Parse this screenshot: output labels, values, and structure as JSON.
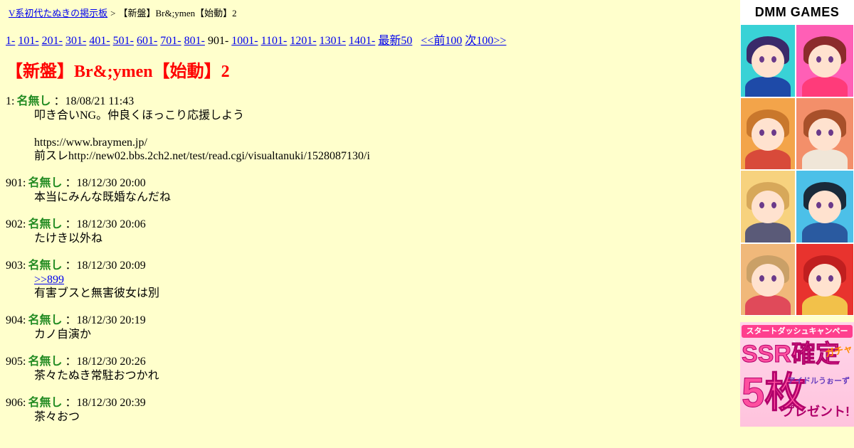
{
  "breadcrumb": {
    "board_link": "V系初代たぬきの掲示板",
    "separator": ">",
    "current": "【新盤】Br&;ymen【始動】2"
  },
  "pager": {
    "pages": [
      "1-",
      "101-",
      "201-",
      "301-",
      "401-",
      "501-",
      "601-",
      "701-",
      "801-",
      "901-",
      "1001-",
      "1101-",
      "1201-",
      "1301-",
      "1401-"
    ],
    "current": "901-",
    "latest": "最新50",
    "prev": "<<前100",
    "next": "次100>>"
  },
  "thread_title": "【新盤】Br&;ymen【始動】2",
  "posts": [
    {
      "num": "1:",
      "name": "名無し",
      "date": "：18/08/21 11:43",
      "lines": [
        "叩き合いNG。仲良くほっこり応援しよう",
        "",
        "https://www.braymen.jp/",
        "前スレhttp://new02.bbs.2ch2.net/test/read.cgi/visualtanuki/1528087130/i"
      ]
    },
    {
      "num": "901:",
      "name": "名無し",
      "date": "：18/12/30 20:00",
      "lines": [
        "本当にみんな既婚なんだね"
      ]
    },
    {
      "num": "902:",
      "name": "名無し",
      "date": "：18/12/30 20:06",
      "lines": [
        "たけき以外ね"
      ]
    },
    {
      "num": "903:",
      "name": "名無し",
      "date": "：18/12/30 20:09",
      "anchor": ">>899",
      "lines": [
        "有害ブスと無害彼女は別"
      ]
    },
    {
      "num": "904:",
      "name": "名無し",
      "date": "：18/12/30 20:19",
      "lines": [
        "カノ自演か"
      ]
    },
    {
      "num": "905:",
      "name": "名無し",
      "date": "：18/12/30 20:26",
      "lines": [
        "茶々たぬき常駐おつかれ"
      ]
    },
    {
      "num": "906:",
      "name": "名無し",
      "date": "：18/12/30 20:39",
      "lines": [
        "茶々おつ"
      ]
    }
  ],
  "ads": {
    "logo": "DMM GAMES",
    "banner": {
      "top": "スタートダッシュキャンペーン!",
      "ssr": "SSR確定",
      "gacha": "ガチャ",
      "five": "5枚",
      "game": "アイドルうぉーず",
      "present": "プレゼント!"
    },
    "tile_colors": [
      {
        "bg": "#39d2d6",
        "hair": "#3a2a6a",
        "body": "#1e4aa8"
      },
      {
        "bg": "#ff5fb6",
        "hair": "#8b2b2b",
        "body": "#ff3b7a"
      },
      {
        "bg": "#f3a44a",
        "hair": "#c9772c",
        "body": "#d84a3a"
      },
      {
        "bg": "#f38f6a",
        "hair": "#a8502a",
        "body": "#f0e6d8"
      },
      {
        "bg": "#f7d27e",
        "hair": "#d7a85a",
        "body": "#5a5a78"
      },
      {
        "bg": "#4cc0e8",
        "hair": "#1a2a3a",
        "body": "#2a5aa0"
      },
      {
        "bg": "#f0b87a",
        "hair": "#caa067",
        "body": "#e04a5a"
      },
      {
        "bg": "#e8332e",
        "hair": "#c01f1f",
        "body": "#f2c14a"
      }
    ]
  }
}
